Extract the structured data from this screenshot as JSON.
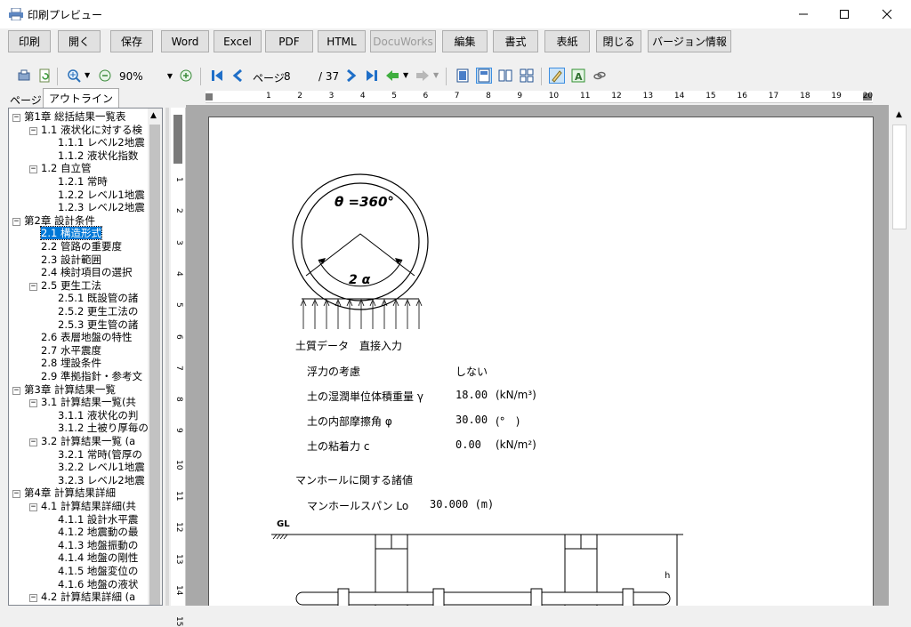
{
  "window": {
    "title": "印刷プレビュー"
  },
  "toolbar1": {
    "buttons": [
      {
        "id": "print",
        "label": "印刷"
      },
      {
        "id": "open",
        "label": "開く"
      },
      {
        "id": "save",
        "label": "保存"
      },
      {
        "id": "word",
        "label": "Word"
      },
      {
        "id": "excel",
        "label": "Excel"
      },
      {
        "id": "pdf",
        "label": "PDF"
      },
      {
        "id": "html",
        "label": "HTML"
      },
      {
        "id": "docuworks",
        "label": "DocuWorks",
        "disabled": true
      },
      {
        "id": "edit",
        "label": "編集"
      },
      {
        "id": "format",
        "label": "書式"
      },
      {
        "id": "cover",
        "label": "表紙"
      },
      {
        "id": "close",
        "label": "閉じる"
      },
      {
        "id": "version",
        "label": "バージョン情報"
      }
    ]
  },
  "toolbar2": {
    "zoom": "90%",
    "page_label": "ページ",
    "page_current": "8",
    "page_total": "/ 37"
  },
  "tabs": {
    "page": "ページ",
    "outline": "アウトライン"
  },
  "ruler": {
    "h": [
      "1",
      "2",
      "3",
      "4",
      "5",
      "6",
      "7",
      "8",
      "9",
      "10",
      "11",
      "12",
      "13",
      "14",
      "15",
      "16",
      "17",
      "18",
      "19",
      "20"
    ],
    "v": [
      "1",
      "2",
      "3",
      "4",
      "5",
      "6",
      "7",
      "8",
      "9",
      "10",
      "11",
      "12",
      "13",
      "14",
      "15"
    ]
  },
  "outline": [
    {
      "level": 0,
      "toggle": "−",
      "label": "第1章 総括結果一覧表"
    },
    {
      "level": 1,
      "toggle": "−",
      "label": "1.1 液状化に対する検"
    },
    {
      "level": 2,
      "label": "1.1.1 レベル2地震"
    },
    {
      "level": 2,
      "label": "1.1.2 液状化指数"
    },
    {
      "level": 1,
      "toggle": "−",
      "label": "1.2 自立管"
    },
    {
      "level": 2,
      "label": "1.2.1 常時"
    },
    {
      "level": 2,
      "label": "1.2.2 レベル1地震"
    },
    {
      "level": 2,
      "label": "1.2.3 レベル2地震"
    },
    {
      "level": 0,
      "toggle": "−",
      "label": "第2章 設計条件"
    },
    {
      "level": 1,
      "label": "2.1 構造形式",
      "selected": true
    },
    {
      "level": 1,
      "label": "2.2 管路の重要度"
    },
    {
      "level": 1,
      "label": "2.3 設計範囲"
    },
    {
      "level": 1,
      "label": "2.4 検討項目の選択"
    },
    {
      "level": 1,
      "toggle": "−",
      "label": "2.5 更生工法"
    },
    {
      "level": 2,
      "label": "2.5.1 既設管の諸"
    },
    {
      "level": 2,
      "label": "2.5.2 更生工法の"
    },
    {
      "level": 2,
      "label": "2.5.3 更生管の諸"
    },
    {
      "level": 1,
      "label": "2.6 表層地盤の特性"
    },
    {
      "level": 1,
      "label": "2.7 水平震度"
    },
    {
      "level": 1,
      "label": "2.8 埋設条件"
    },
    {
      "level": 1,
      "label": "2.9 準拠指針・参考文"
    },
    {
      "level": 0,
      "toggle": "−",
      "label": "第3章 計算結果一覧"
    },
    {
      "level": 1,
      "toggle": "−",
      "label": "3.1 計算結果一覧(共"
    },
    {
      "level": 2,
      "label": "3.1.1 液状化の判"
    },
    {
      "level": 2,
      "label": "3.1.2 土被り厚毎の"
    },
    {
      "level": 1,
      "toggle": "−",
      "label": "3.2 計算結果一覧 (a"
    },
    {
      "level": 2,
      "label": "3.2.1 常時(管厚の"
    },
    {
      "level": 2,
      "label": "3.2.2 レベル1地震"
    },
    {
      "level": 2,
      "label": "3.2.3 レベル2地震"
    },
    {
      "level": 0,
      "toggle": "−",
      "label": "第4章 計算結果詳細"
    },
    {
      "level": 1,
      "toggle": "−",
      "label": "4.1 計算結果詳細(共"
    },
    {
      "level": 2,
      "label": "4.1.1 設計水平震"
    },
    {
      "level": 2,
      "label": "4.1.2 地震動の最"
    },
    {
      "level": 2,
      "label": "4.1.3 地盤振動の"
    },
    {
      "level": 2,
      "label": "4.1.4 地盤の剛性"
    },
    {
      "level": 2,
      "label": "4.1.5 地盤変位の"
    },
    {
      "level": 2,
      "label": "4.1.6 地盤の液状"
    },
    {
      "level": 1,
      "toggle": "−",
      "label": "4.2 計算結果詳細 (a"
    }
  ],
  "document": {
    "theta_label": "θ =360°",
    "alpha_label": "2 α",
    "soil_header": "土質データ　直接入力",
    "soil_rows": [
      {
        "name": "浮力の考慮",
        "value": "しない",
        "unit": ""
      },
      {
        "name": "土の湿潤単位体積重量 γ",
        "value": "18.00",
        "unit": "(kN/m³)"
      },
      {
        "name": "土の内部摩擦角 φ",
        "value": "30.00",
        "unit": "(°　)"
      },
      {
        "name": "土の粘着力 c",
        "value": "0.00",
        "unit": "(kN/m²)"
      }
    ],
    "manhole_header": "マンホールに関する諸値",
    "manhole_span_label": "マンホールスパン Lo",
    "manhole_span_value": "30.000 (m)",
    "gl_label": "GL",
    "h_label": "h"
  }
}
